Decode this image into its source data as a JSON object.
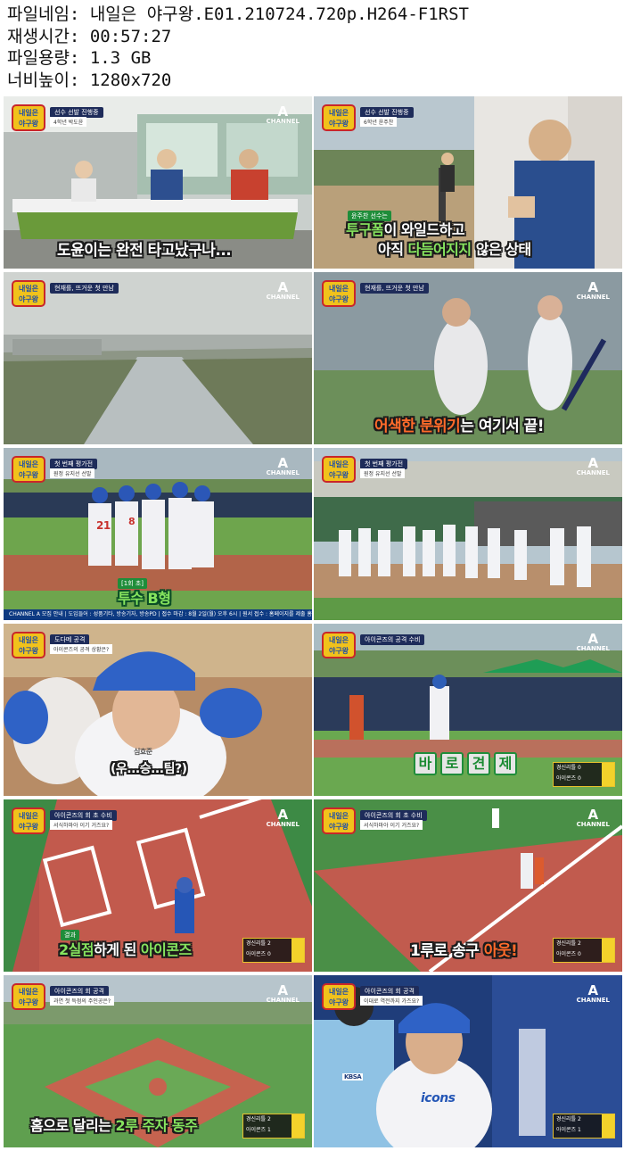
{
  "file_info": {
    "filename_label": "파일네임:",
    "filename_value": "내일은 야구왕.E01.210724.720p.H264-F1RST",
    "duration_label": "재생시간:",
    "duration_value": "00:57:27",
    "size_label": "파일용량:",
    "size_value": "1.3 GB",
    "resolution_label": "너비높이:",
    "resolution_value": "1280x720"
  },
  "show_logo": {
    "line1": "내일은",
    "line2": "야구왕"
  },
  "channel_logo": {
    "letter": "A",
    "word": "CHANNEL"
  },
  "thumbnails": [
    {
      "caption": "도윤이는 완전 타고났구나...",
      "tag": "선수 선발 진행중",
      "tag2": "4학년 박도윤"
    },
    {
      "caption_line1a": "투구폼",
      "caption_line1b": "이 와일드하고",
      "caption_line2a": "아직 ",
      "caption_line2b": "다듬어지지",
      "caption_line2c": " 않은 상태",
      "tag": "선수 선발 진행중",
      "tag2": "6학년 윤주찬",
      "name_label": "윤주찬 선수는"
    },
    {
      "tag": "현재를, 뜨거운 첫 만남"
    },
    {
      "caption_a": "어색한 분위기",
      "caption_b": "는 여기서 끝!",
      "tag": "현재를, 뜨거운 첫 만남"
    },
    {
      "label": "[1회 초]",
      "caption": "투수 B형",
      "tag": "첫 번째 평가전",
      "tag2": "원정 유지선 선발",
      "ticker": "CHANNEL A   모집 안내  |  도입들어 : 성품기타, 방송기자, 방송PD  |  접수 마감 : 8월 2일(월) 오후 6시  |  원서 접수 : 홈페이지를 제출 홈페이지",
      "jersey_number": "21",
      "jersey_number2": "8"
    },
    {
      "tag": "첫 번째 평가전",
      "tag2": "원정 유지선 선발"
    },
    {
      "caption": "(우...승...팀?)",
      "tag": "도다메 공격",
      "tag2": "아이콘즈의 공격 상황은?",
      "name": "심효준"
    },
    {
      "tiles": [
        "바",
        "로",
        "견",
        "제"
      ],
      "tag": "아이콘즈의 공격 수비",
      "score_team1": "경신리틀",
      "score_team2": "아이콘즈",
      "score_v1": "0",
      "score_v2": "0"
    },
    {
      "caption_a": "2실점",
      "caption_b": "하게 된 ",
      "caption_c": "아이콘즈",
      "label": "결과",
      "tag": "아이콘즈의 회 초 수비",
      "tag2": "서식하마아 이기 거즈요?",
      "score_team1": "경신리틀",
      "score_team2": "아이콘즈",
      "score_v1": "2",
      "score_v2": "0"
    },
    {
      "caption_a": "1루로 송구 ",
      "caption_b": "아웃!",
      "tag": "아이콘즈의 회 초 수비",
      "tag2": "서식하마아 이기 거즈요?",
      "score_team1": "경신리틀",
      "score_team2": "아이콘즈",
      "score_v1": "2",
      "score_v2": "0"
    },
    {
      "caption_a": "홈으로 달리는 ",
      "caption_b": "2루 주자 동주",
      "tag": "아이콘즈의 회 공격",
      "tag2": "과연 첫 득점의 주인공은?",
      "score_team1": "경신리틀",
      "score_team2": "아이콘즈",
      "score_v1": "2",
      "score_v2": "1"
    },
    {
      "tag": "아이콘즈의 회 공격",
      "tag2": "이대로 역전까지 가즈요?",
      "badge": "KBSA",
      "jersey_text": "icons",
      "score_team1": "경신리틀",
      "score_team2": "아이콘즈",
      "score_v1": "2",
      "score_v2": "1"
    }
  ]
}
